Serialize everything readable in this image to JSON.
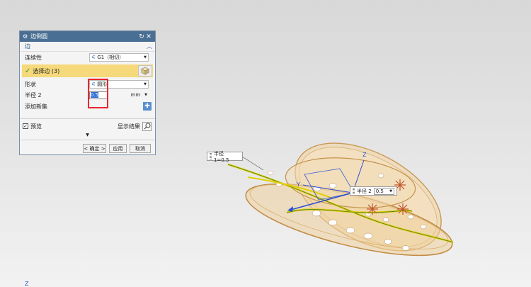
{
  "dialog": {
    "title": "边倒圆",
    "section": "边",
    "continuity_label": "连续性",
    "continuity_value": "G1（相切）",
    "select_edge_label": "选择边 (3)",
    "shape_label": "形状",
    "shape_value": "圆形",
    "radius_label": "半径 2",
    "radius_value": "0.5",
    "radius_unit": "mm",
    "add_set_label": "添加新集",
    "preview_label": "预览",
    "show_result_label": "显示结果",
    "ok_label": "< 确定 >",
    "apply_label": "应用",
    "cancel_label": "取消"
  },
  "viewport": {
    "callout_radius1": "半径 1=0.5",
    "callout_radius2_label": "半径 2",
    "callout_radius2_value": "0.5",
    "axis_z": "Z",
    "axis_y": "Y"
  },
  "colors": {
    "titlebar": "#4a6f94",
    "selection_highlight": "#f5d97a",
    "annotation_red": "#e8262e",
    "model_fill": "#eec58a",
    "edge_yellow": "#e0d000"
  }
}
